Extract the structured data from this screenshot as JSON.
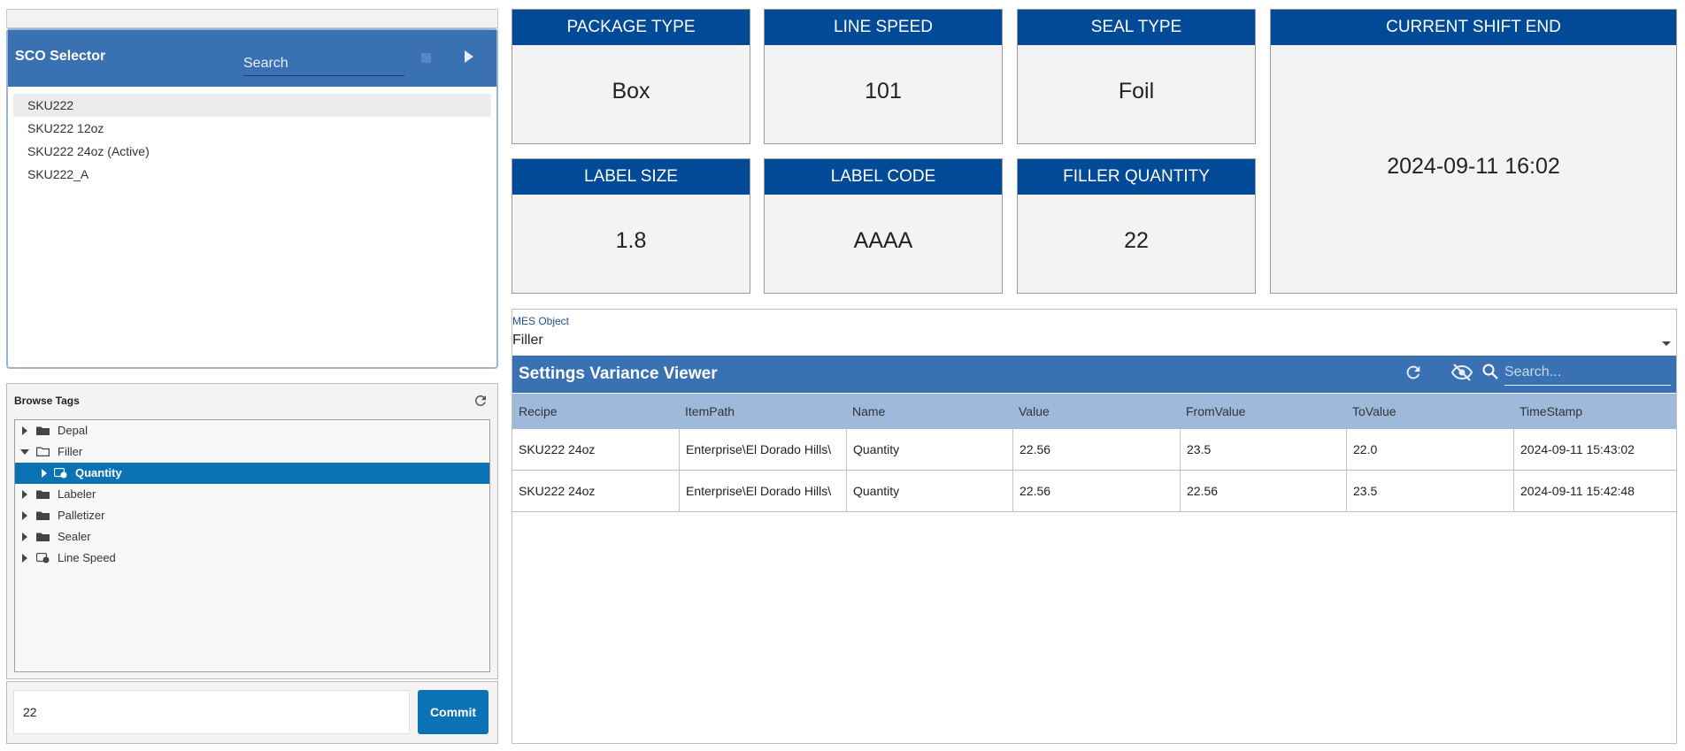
{
  "sco_selector": {
    "title": "SCO Selector",
    "search_placeholder": "Search",
    "items": [
      {
        "label": "SKU222",
        "selected": true
      },
      {
        "label": "SKU222 12oz",
        "selected": false
      },
      {
        "label": "SKU222 24oz (Active)",
        "selected": false
      },
      {
        "label": "SKU222_A",
        "selected": false
      }
    ]
  },
  "browse_tags": {
    "title": "Browse Tags",
    "tree": [
      {
        "label": "Depal",
        "icon": "folder-icon",
        "expanded": false,
        "level": 0
      },
      {
        "label": "Filler",
        "icon": "folder-open-icon",
        "expanded": true,
        "level": 0
      },
      {
        "label": "Quantity",
        "icon": "tag-icon",
        "expanded": false,
        "level": 1,
        "selected": true
      },
      {
        "label": "Labeler",
        "icon": "folder-icon",
        "expanded": false,
        "level": 0
      },
      {
        "label": "Palletizer",
        "icon": "folder-icon",
        "expanded": false,
        "level": 0
      },
      {
        "label": "Sealer",
        "icon": "folder-icon",
        "expanded": false,
        "level": 0
      },
      {
        "label": "Line Speed",
        "icon": "tag-icon",
        "expanded": false,
        "level": 0
      }
    ]
  },
  "commit": {
    "value": "22",
    "button_label": "Commit"
  },
  "cards": {
    "package_type": {
      "title": "PACKAGE TYPE",
      "value": "Box"
    },
    "line_speed": {
      "title": "LINE SPEED",
      "value": "101"
    },
    "seal_type": {
      "title": "SEAL TYPE",
      "value": "Foil"
    },
    "shift_end": {
      "title": "CURRENT SHIFT END",
      "value": "2024-09-11 16:02"
    },
    "label_size": {
      "title": "LABEL SIZE",
      "value": "1.8"
    },
    "label_code": {
      "title": "LABEL CODE",
      "value": "AAAA"
    },
    "filler_quantity": {
      "title": "FILLER QUANTITY",
      "value": "22"
    }
  },
  "mes_object": {
    "label": "MES Object",
    "value": "Filler"
  },
  "variance_viewer": {
    "title": "Settings Variance Viewer",
    "search_placeholder": "Search...",
    "columns": [
      "Recipe",
      "ItemPath",
      "Name",
      "Value",
      "FromValue",
      "ToValue",
      "TimeStamp"
    ],
    "rows": [
      [
        "SKU222 24oz",
        "Enterprise\\El Dorado Hills\\",
        "Quantity",
        "22.56",
        "23.5",
        "22.0",
        "2024-09-11 15:43:02"
      ],
      [
        "SKU222 24oz",
        "Enterprise\\El Dorado Hills\\",
        "Quantity",
        "22.56",
        "22.56",
        "23.5",
        "2024-09-11 15:42:48"
      ]
    ]
  },
  "colors": {
    "header_blue": "#3a71b3",
    "card_blue": "#004a98",
    "selected_blue": "#0b73b4",
    "grid_header": "#9eb9da"
  }
}
